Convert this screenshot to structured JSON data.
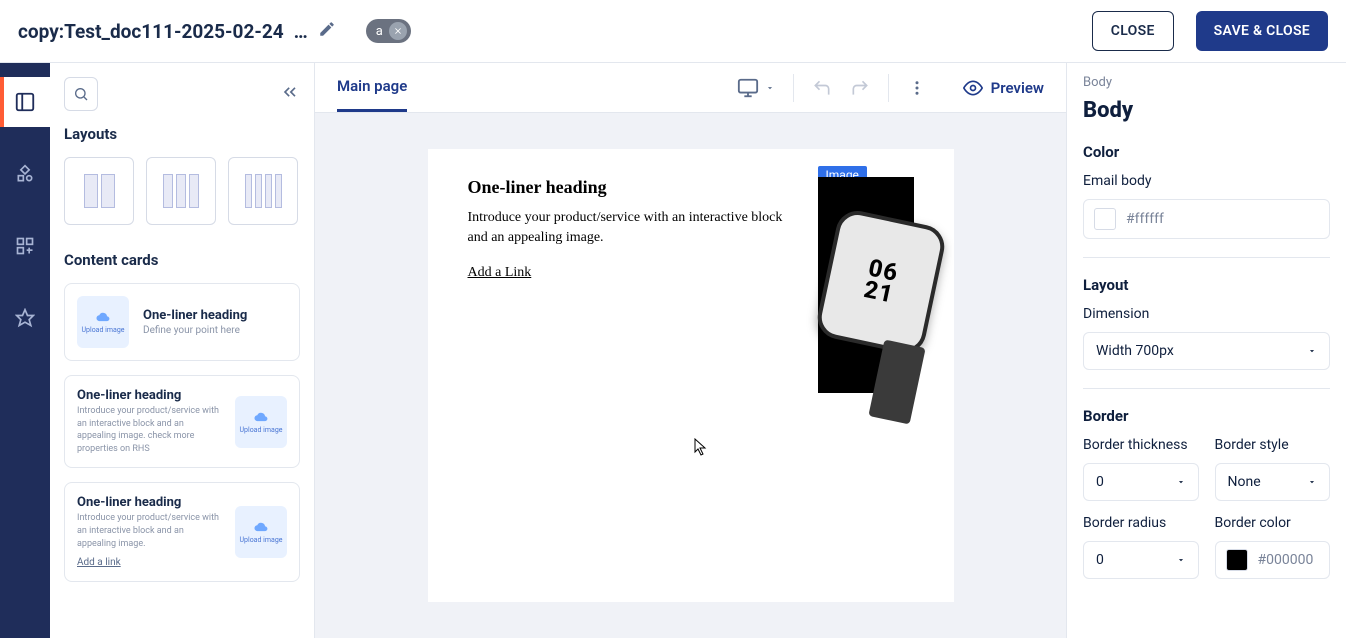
{
  "header": {
    "doc_title": "copy:Test_doc111-2025-02-24",
    "ellipsis": "…",
    "chip_label": "a",
    "close_label": "CLOSE",
    "save_close_label": "SAVE & CLOSE"
  },
  "sidebar": {
    "layouts_title": "Layouts",
    "content_cards_title": "Content cards",
    "card_thumb_label": "Upload image",
    "card1": {
      "heading": "One-liner heading",
      "sub": "Define your point here"
    },
    "card2": {
      "heading": "One-liner heading",
      "sub": "Introduce your product/service with an interactive block and an appealing image. check more properties on RHS"
    },
    "card3": {
      "heading": "One-liner heading",
      "sub": "Introduce your product/service with an interactive block and an appealing image.",
      "link": "Add a link"
    }
  },
  "canvas": {
    "tab_main": "Main page",
    "preview_label": "Preview",
    "block": {
      "heading": "One-liner heading",
      "paragraph": "Introduce your product/service with an interactive block and an appealing image.",
      "link": "Add a Link",
      "image_label": "Image",
      "watch_time1": "06",
      "watch_time2": "21"
    }
  },
  "props": {
    "breadcrumb": "Body",
    "title": "Body",
    "section_color": "Color",
    "email_body_label": "Email body",
    "email_body_color": "#ffffff",
    "section_layout": "Layout",
    "dimension_label": "Dimension",
    "dimension_value": "Width 700px",
    "section_border": "Border",
    "border_thickness_label": "Border thickness",
    "border_thickness_value": "0",
    "border_style_label": "Border style",
    "border_style_value": "None",
    "border_radius_label": "Border radius",
    "border_radius_value": "0",
    "border_color_label": "Border color",
    "border_color_value": "#000000"
  }
}
